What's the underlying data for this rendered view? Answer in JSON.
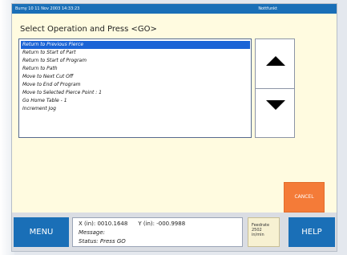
{
  "window": {
    "title_left": "Burny 10 11 Nov 2003 14:33:23",
    "title_right": "Nottfunkt"
  },
  "heading": "Select Operation and Press <GO>",
  "operations": [
    "Return to Previous Pierce",
    "Return to Start of Part",
    "Return to Start of Program",
    "Return to Path",
    "Move to Next Cut Off",
    "Move to End of Program",
    "Move to Selected Pierce Point : 1",
    "Go Home Table - 1",
    "Increment Jog"
  ],
  "selected_index": 0,
  "buttons": {
    "cancel": "CANCEL",
    "menu": "MENU",
    "help": "HELP"
  },
  "status": {
    "x_label": "X (in): 0010.1648",
    "y_label": "Y (in): -000.9988",
    "message_label": "Message:",
    "status_line": "Status: Press GO"
  },
  "feedrate": {
    "label": "Feedrate",
    "value": "2502",
    "unit": "in/min"
  },
  "colors": {
    "blue": "#1a6fb7",
    "orange": "#f47b38",
    "selection": "#1b64d6"
  }
}
